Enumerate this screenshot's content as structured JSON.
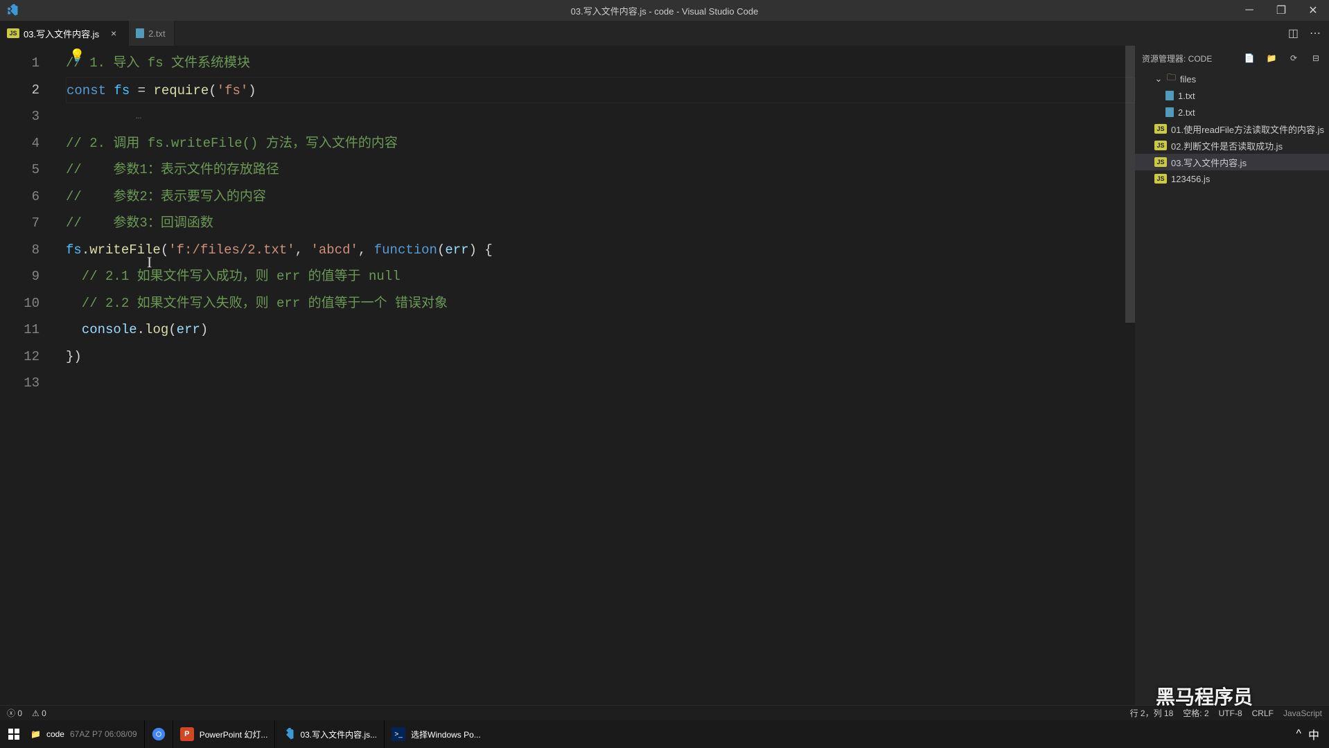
{
  "title_bar": {
    "title": "03.写入文件内容.js - code - Visual Studio Code"
  },
  "tabs": [
    {
      "label": "03.写入文件内容.js",
      "icon": "JS",
      "active": true
    },
    {
      "label": "2.txt",
      "icon": "txt",
      "active": false
    }
  ],
  "code": {
    "lines": {
      "n1": "1",
      "n2": "2",
      "n3": "3",
      "n4": "4",
      "n5": "5",
      "n6": "6",
      "n7": "7",
      "n8": "8",
      "n9": "9",
      "n10": "10",
      "n11": "11",
      "n12": "12",
      "n13": "13"
    },
    "l1_comment": "// 1. 导入 fs 文件系统模块",
    "l2_const": "const ",
    "l2_fs": "fs",
    "l2_eq": " = ",
    "l2_require": "require",
    "l2_paren_open": "(",
    "l2_str": "'fs'",
    "l2_paren_close": ")",
    "l4_comment": "// 2. 调用 fs.writeFile() 方法，写入文件的内容",
    "l5_comment": "//    参数1：表示文件的存放路径",
    "l6_comment": "//    参数2：表示要写入的内容",
    "l7_comment": "//    参数3：回调函数",
    "l8_fs": "fs",
    "l8_dot": ".",
    "l8_write": "writeFile",
    "l8_open": "(",
    "l8_str1": "'f:/files/2.txt'",
    "l8_c1": ", ",
    "l8_str2": "'abcd'",
    "l8_c2": ", ",
    "l8_func": "function",
    "l8_po": "(",
    "l8_err": "err",
    "l8_pc": ") {",
    "l9_comment": "  // 2.1 如果文件写入成功，则 err 的值等于 null",
    "l10_comment": "  // 2.2 如果文件写入失败，则 err 的值等于一个 错误对象",
    "l11_indent": "  ",
    "l11_console": "console",
    "l11_dot": ".",
    "l11_log": "log",
    "l11_open": "(",
    "l11_err": "err",
    "l11_close": ")",
    "l12": "})"
  },
  "explorer": {
    "title": "资源管理器: CODE",
    "folders": {
      "files": "files"
    },
    "files": {
      "f1": "1.txt",
      "f2": "2.txt",
      "f3": "01.使用readFile方法读取文件的内容.js",
      "f4": "02.判断文件是否读取成功.js",
      "f5": "03.写入文件内容.js",
      "f6": "123456.js"
    }
  },
  "status": {
    "errors": "0",
    "warnings": "0",
    "ln_col": "行 2，列 18",
    "spaces": "空格: 2",
    "encoding": "UTF-8",
    "eol": "CRLF",
    "lang": "JavaScript"
  },
  "taskbar": {
    "code_folder": "code",
    "timestamp_fragment": "67AZ P7 06:08/09",
    "powerpoint": "PowerPoint 幻灯...",
    "vscode_task": "03.写入文件内容.js...",
    "powershell": "选择Windows Po..."
  },
  "watermark": {
    "w1": "黑马程序员"
  }
}
